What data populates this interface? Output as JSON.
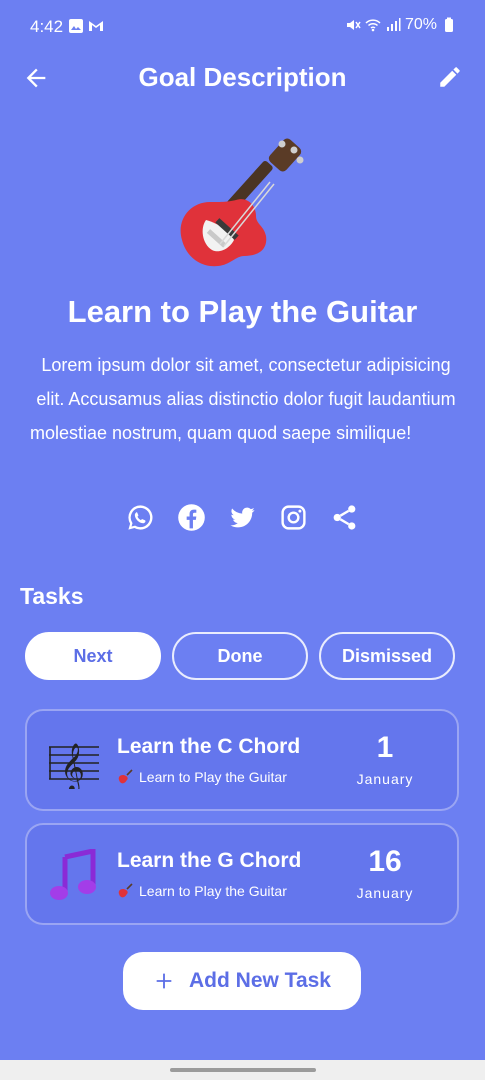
{
  "status_bar": {
    "time": "4:42",
    "battery": "70%"
  },
  "header": {
    "title": "Goal Description",
    "back_icon": "arrow-left-icon",
    "edit_icon": "pencil-icon"
  },
  "goal": {
    "emoji": "guitar",
    "title": "Learn to Play the Guitar",
    "description": "Lorem ipsum dolor sit amet, consectetur adipisicing elit. Accusamus alias distinctio dolor fugit laudantium molestiae nostrum, quam quod saepe similique!"
  },
  "share": {
    "icons": [
      "whatsapp-icon",
      "facebook-icon",
      "twitter-icon",
      "instagram-icon",
      "share-icon"
    ]
  },
  "tasks": {
    "heading": "Tasks",
    "tabs": [
      {
        "label": "Next",
        "active": true
      },
      {
        "label": "Done",
        "active": false
      },
      {
        "label": "Dismissed",
        "active": false
      }
    ],
    "items": [
      {
        "name": "Learn the C Chord",
        "goal": "Learn to Play the Guitar",
        "day": "1",
        "month": "January",
        "icon": "treble-clef-staff"
      },
      {
        "name": "Learn the G Chord",
        "goal": "Learn to Play the Guitar",
        "day": "16",
        "month": "January",
        "icon": "music-notes"
      }
    ],
    "add_label": "Add New Task"
  },
  "colors": {
    "background": "#6c7ff2",
    "accent": "#5c6ee6",
    "card": "#6476ed"
  }
}
